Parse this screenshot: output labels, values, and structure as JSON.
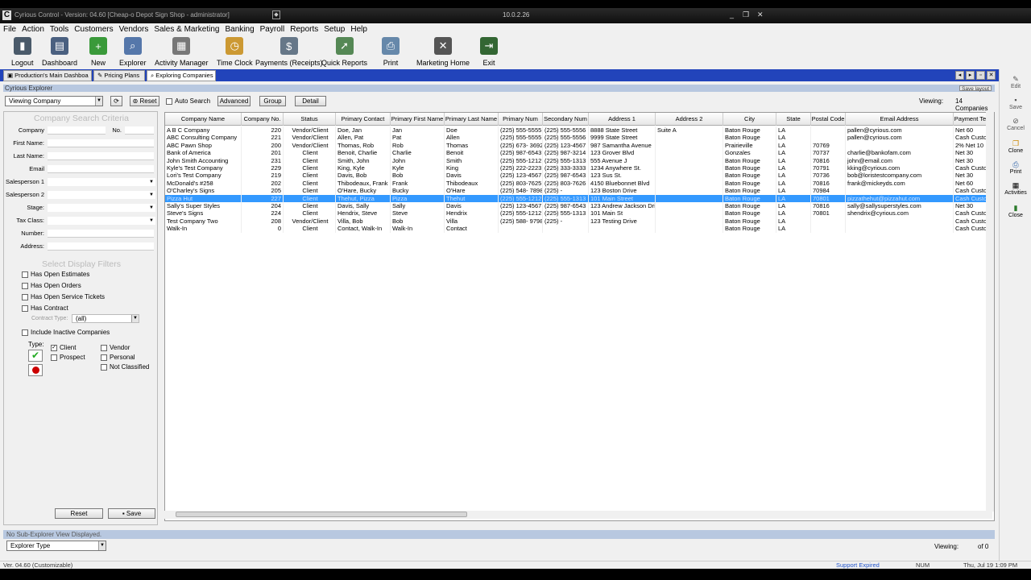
{
  "titlebar": {
    "app_icon": "C",
    "title": "Cyrious Control - Version: 04.60 [Cheap-o Depot Sign Shop - administrator]",
    "ip": "10.0.2.26",
    "controls": [
      "_",
      "❐",
      "✕"
    ]
  },
  "menu": [
    "File",
    "Action",
    "Tools",
    "Customers",
    "Vendors",
    "Sales & Marketing",
    "Banking",
    "Payroll",
    "Reports",
    "Setup",
    "Help"
  ],
  "toolbar": {
    "buttons": [
      {
        "label": "Logout",
        "icon": "logout-icon",
        "color": "#4a5a6a"
      },
      {
        "label": "Dashboard",
        "icon": "dashboard-icon",
        "color": "#4a6080"
      },
      {
        "label": "New",
        "icon": "new-icon",
        "color": "#3a9a3a"
      },
      {
        "label": "Explorer",
        "icon": "explorer-icon",
        "color": "#5577aa"
      },
      {
        "label": "Activity Manager",
        "icon": "calendar-icon",
        "color": "#777777"
      },
      {
        "label": "Time Clock",
        "icon": "time-clock-icon",
        "color": "#cc9933"
      },
      {
        "label": "Payments (Receipts)",
        "icon": "payments-icon",
        "color": "#667788"
      },
      {
        "label": "Quick Reports",
        "icon": "quick-reports-icon",
        "color": "#558855"
      },
      {
        "label": "Print",
        "icon": "print-icon",
        "color": "#6688aa"
      },
      {
        "label": "Marketing Home",
        "icon": "marketing-home-icon",
        "color": "#555555"
      },
      {
        "label": "Exit",
        "icon": "exit-icon",
        "color": "#336633"
      }
    ]
  },
  "tabs": [
    {
      "label": "Production's Main Dashboa"
    },
    {
      "label": "Pricing Plans"
    },
    {
      "label": "Exploring Companies"
    }
  ],
  "right_actions": [
    "Edit",
    "Save",
    "Cancel",
    "Clone",
    "Print",
    "Activities",
    "Close"
  ],
  "explorer": {
    "title": "Cyrious Explorer",
    "save_layout": "Save layout",
    "view_combo": "Viewing Company",
    "reset": "Reset",
    "auto_search": "Auto Search",
    "advanced": "Advanced",
    "group": "Group",
    "detail": "Detail",
    "viewing_label": "Viewing:",
    "viewing_count": "14 Companies"
  },
  "search": {
    "header": "Company Search Criteria",
    "company_label": "Company",
    "no_label": "No.",
    "first_name_label": "First Name:",
    "last_name_label": "Last Name:",
    "email_label": "Email",
    "sales1_label": "Salesperson 1",
    "sales2_label": "Salesperson 2",
    "stage_label": "Stage:",
    "taxclass_label": "Tax Class:",
    "number_label": "Number:",
    "address_label": "Address:",
    "filters_header": "Select Display Filters",
    "filters": [
      "Has Open Estimates",
      "Has Open Orders",
      "Has Open Service Tickets",
      "Has Contract"
    ],
    "contract_type_label": "Contract Type:",
    "contract_type_value": "(all)",
    "include_inactive": "Include Inactive Companies",
    "type_label": "Type:",
    "types": [
      {
        "label": "Client",
        "checked": true
      },
      {
        "label": "Vendor",
        "checked": false
      },
      {
        "label": "Prospect",
        "checked": false
      },
      {
        "label": "Personal",
        "checked": false
      },
      {
        "label": "Not Classified",
        "checked": false
      }
    ],
    "reset_btn": "Reset",
    "save_btn": "Save"
  },
  "grid": {
    "columns": [
      "Company Name",
      "Company No.",
      "Status",
      "Primary Contact",
      "Primary First Name",
      "Primary Last Name",
      "Primary Num",
      "Secondary Num",
      "Address 1",
      "Address 2",
      "City",
      "State",
      "Postal Code",
      "Email Address",
      "Payment Te"
    ],
    "rows": [
      [
        "A B C Company",
        "220",
        "Vendor/Client",
        "Doe, Jan",
        "Jan",
        "Doe",
        "(225) 555-5555",
        "(225) 555-5556",
        "8888 State Street",
        "Suite A",
        "Baton Rouge",
        "LA",
        "",
        "pallen@cyrious.com",
        "Net 60"
      ],
      [
        "ABC Consulting Company",
        "221",
        "Vendor/Client",
        "Allen, Pat",
        "Pat",
        "Allen",
        "(225) 555-5555",
        "(225) 555-5556",
        "9999 State Street",
        "",
        "Baton Rouge",
        "LA",
        "",
        "pallen@cyrious.com",
        "Cash Custor"
      ],
      [
        "ABC Pawn Shop",
        "200",
        "Vendor/Client",
        "Thomas, Rob",
        "Rob",
        "Thomas",
        "(225) 673- 3692",
        "(225) 123-4567",
        "987 Samantha Avenue",
        "",
        "Prairieville",
        "LA",
        "70769",
        "",
        "2% Net 10"
      ],
      [
        "Bank of America",
        "201",
        "Client",
        "Benoit, Charlie",
        "Charlie",
        "Benoit",
        "(225) 987-6543",
        "(225) 987-3214",
        "123 Grover Blvd",
        "",
        "Gonzales",
        "LA",
        "70737",
        "charlie@bankofam.com",
        "Net 30"
      ],
      [
        "John Smith Accounting",
        "231",
        "Client",
        "Smith, John",
        "John",
        "Smith",
        "(225) 555-1212",
        "(225) 555-1313",
        "555 Avenue J",
        "",
        "Baton Rouge",
        "LA",
        "70816",
        "john@email.com",
        "Net 30"
      ],
      [
        "Kyle's Test Company",
        "229",
        "Client",
        "King, Kyle",
        "Kyle",
        "King",
        "(225) 222-2223",
        "(225) 333-3333",
        "1234 Anywhere St.",
        "",
        "Baton Rouge",
        "LA",
        "70791",
        "kking@cyrious.com",
        "Cash Custor"
      ],
      [
        "Lori's Test Company",
        "219",
        "Client",
        "Davis, Bob",
        "Bob",
        "Davis",
        "(225) 123-4567",
        "(225) 987-6543",
        "123 Sus St.",
        "",
        "Baton Rouge",
        "LA",
        "70736",
        "bob@loristestcompany.com",
        "Net 30"
      ],
      [
        "McDonald's #258",
        "202",
        "Client",
        "Thibodeaux, Frank",
        "Frank",
        "Thibodeaux",
        "(225) 803-7625",
        "(225) 803-7626",
        "4150 Bluebonnet Blvd",
        "",
        "Baton Rouge",
        "LA",
        "70816",
        "frank@mickeyds.com",
        "Net 60"
      ],
      [
        "O'Charley's Signs",
        "205",
        "Client",
        "O'Hare, Bucky",
        "Bucky",
        "O'Hare",
        "(225) 548- 7898",
        "(225) -",
        "123 Boston Drive",
        "",
        "Baton Rouge",
        "LA",
        "70984",
        "",
        "Cash Custor"
      ],
      [
        "Pizza Hut",
        "227",
        "Client",
        "Thehut, Pizza",
        "Pizza",
        "Thehut",
        "(225) 555-1212",
        "(225) 555-1313",
        "101 Main Street",
        "",
        "Baton Rouge",
        "LA",
        "70801",
        "pizzathehut@pizzahut.com",
        "Cash Custor"
      ],
      [
        "Sally's Super Styles",
        "204",
        "Client",
        "Davis, Sally",
        "Sally",
        "Davis",
        "(225) 123-4567",
        "(225) 987-6543",
        "123 Andrew Jackson Dri",
        "",
        "Baton Rouge",
        "LA",
        "70816",
        "sally@sallysuperstyles.com",
        "Net 30"
      ],
      [
        "Steve's Signs",
        "224",
        "Client",
        "Hendrix, Steve",
        "Steve",
        "Hendrix",
        "(225) 555-1212",
        "(225) 555-1313",
        "101 Main St",
        "",
        "Baton Rouge",
        "LA",
        "70801",
        "shendrix@cyrious.com",
        "Cash Custor"
      ],
      [
        "Test Company Two",
        "208",
        "Vendor/Client",
        "Villa, Bob",
        "Bob",
        "Villa",
        "(225) 588- 9798",
        "(225) -",
        "123 Testing Drive",
        "",
        "Baton Rouge",
        "LA",
        "",
        "",
        "Cash Custor"
      ],
      [
        "Walk-In",
        "0",
        "Client",
        "Contact, Walk-In",
        "Walk-In",
        "Contact",
        "",
        "",
        "",
        "",
        "Baton Rouge",
        "LA",
        "",
        "",
        "Cash Custor"
      ]
    ],
    "selected_row": 9
  },
  "subexplorer": {
    "text": "No Sub-Explorer View Displayed.",
    "explorer_type": "Explorer Type",
    "viewing_label": "Viewing:",
    "viewing_value": "of 0"
  },
  "status": {
    "version": "Ver. 04.60 (Customizable)",
    "support": "Support Expired",
    "num": "NUM",
    "datetime": "Thu, Jul 19  1:09 PM"
  },
  "colors": {
    "tab_bar": "#2244bb",
    "selection": "#3399ff",
    "support_expired": "#2255cc"
  }
}
